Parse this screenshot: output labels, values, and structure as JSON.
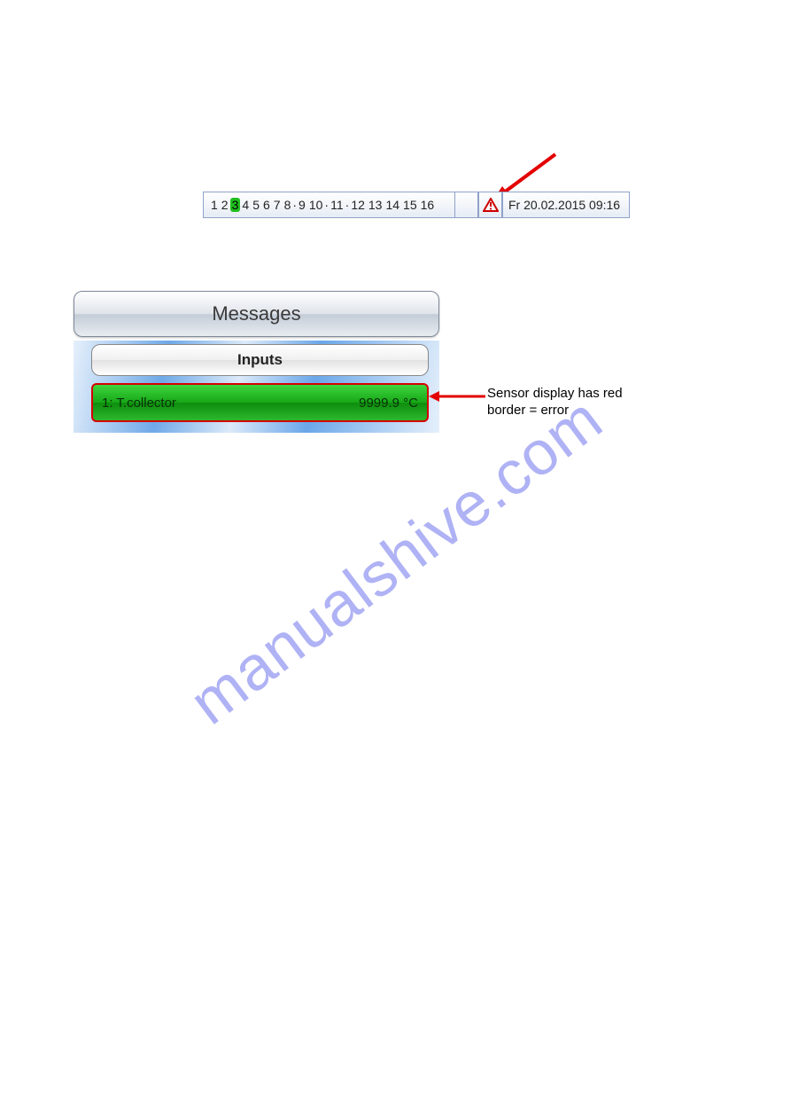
{
  "status_bar": {
    "numbers": [
      "1",
      "2",
      "3",
      "4",
      "5",
      "6",
      "7",
      "8",
      "9",
      "10",
      "11",
      "12",
      "13",
      "14",
      "15",
      "16"
    ],
    "highlighted_index": 2,
    "dot_after": [
      7,
      9,
      10
    ],
    "datetime": "Fr  20.02.2015 09:16"
  },
  "panel": {
    "messages_label": "Messages",
    "inputs_label": "Inputs",
    "sensor": {
      "label": "1: T.collector",
      "value": "9999.9 °C"
    }
  },
  "annotation": {
    "line1": "Sensor display has red",
    "line2": "border = error"
  },
  "watermark": "manualshive.com"
}
